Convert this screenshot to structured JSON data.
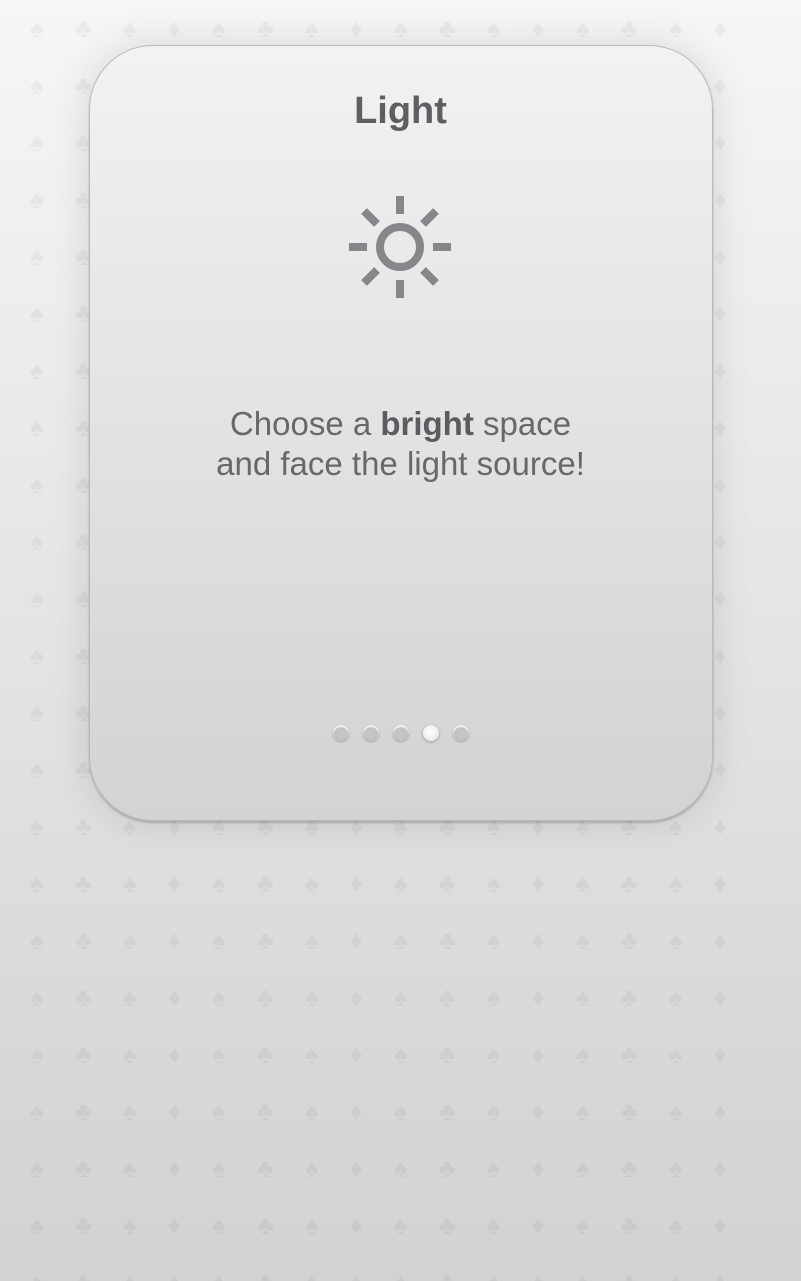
{
  "slide": {
    "title": "Light",
    "icon": "sun-icon",
    "message_pre": "Choose a ",
    "message_bold": "bright",
    "message_post": " space",
    "message_line2": "and face the light source!"
  },
  "pagination": {
    "total": 5,
    "active_index": 3
  },
  "colors": {
    "text": "#5d5f63",
    "icon": "#85878b"
  }
}
